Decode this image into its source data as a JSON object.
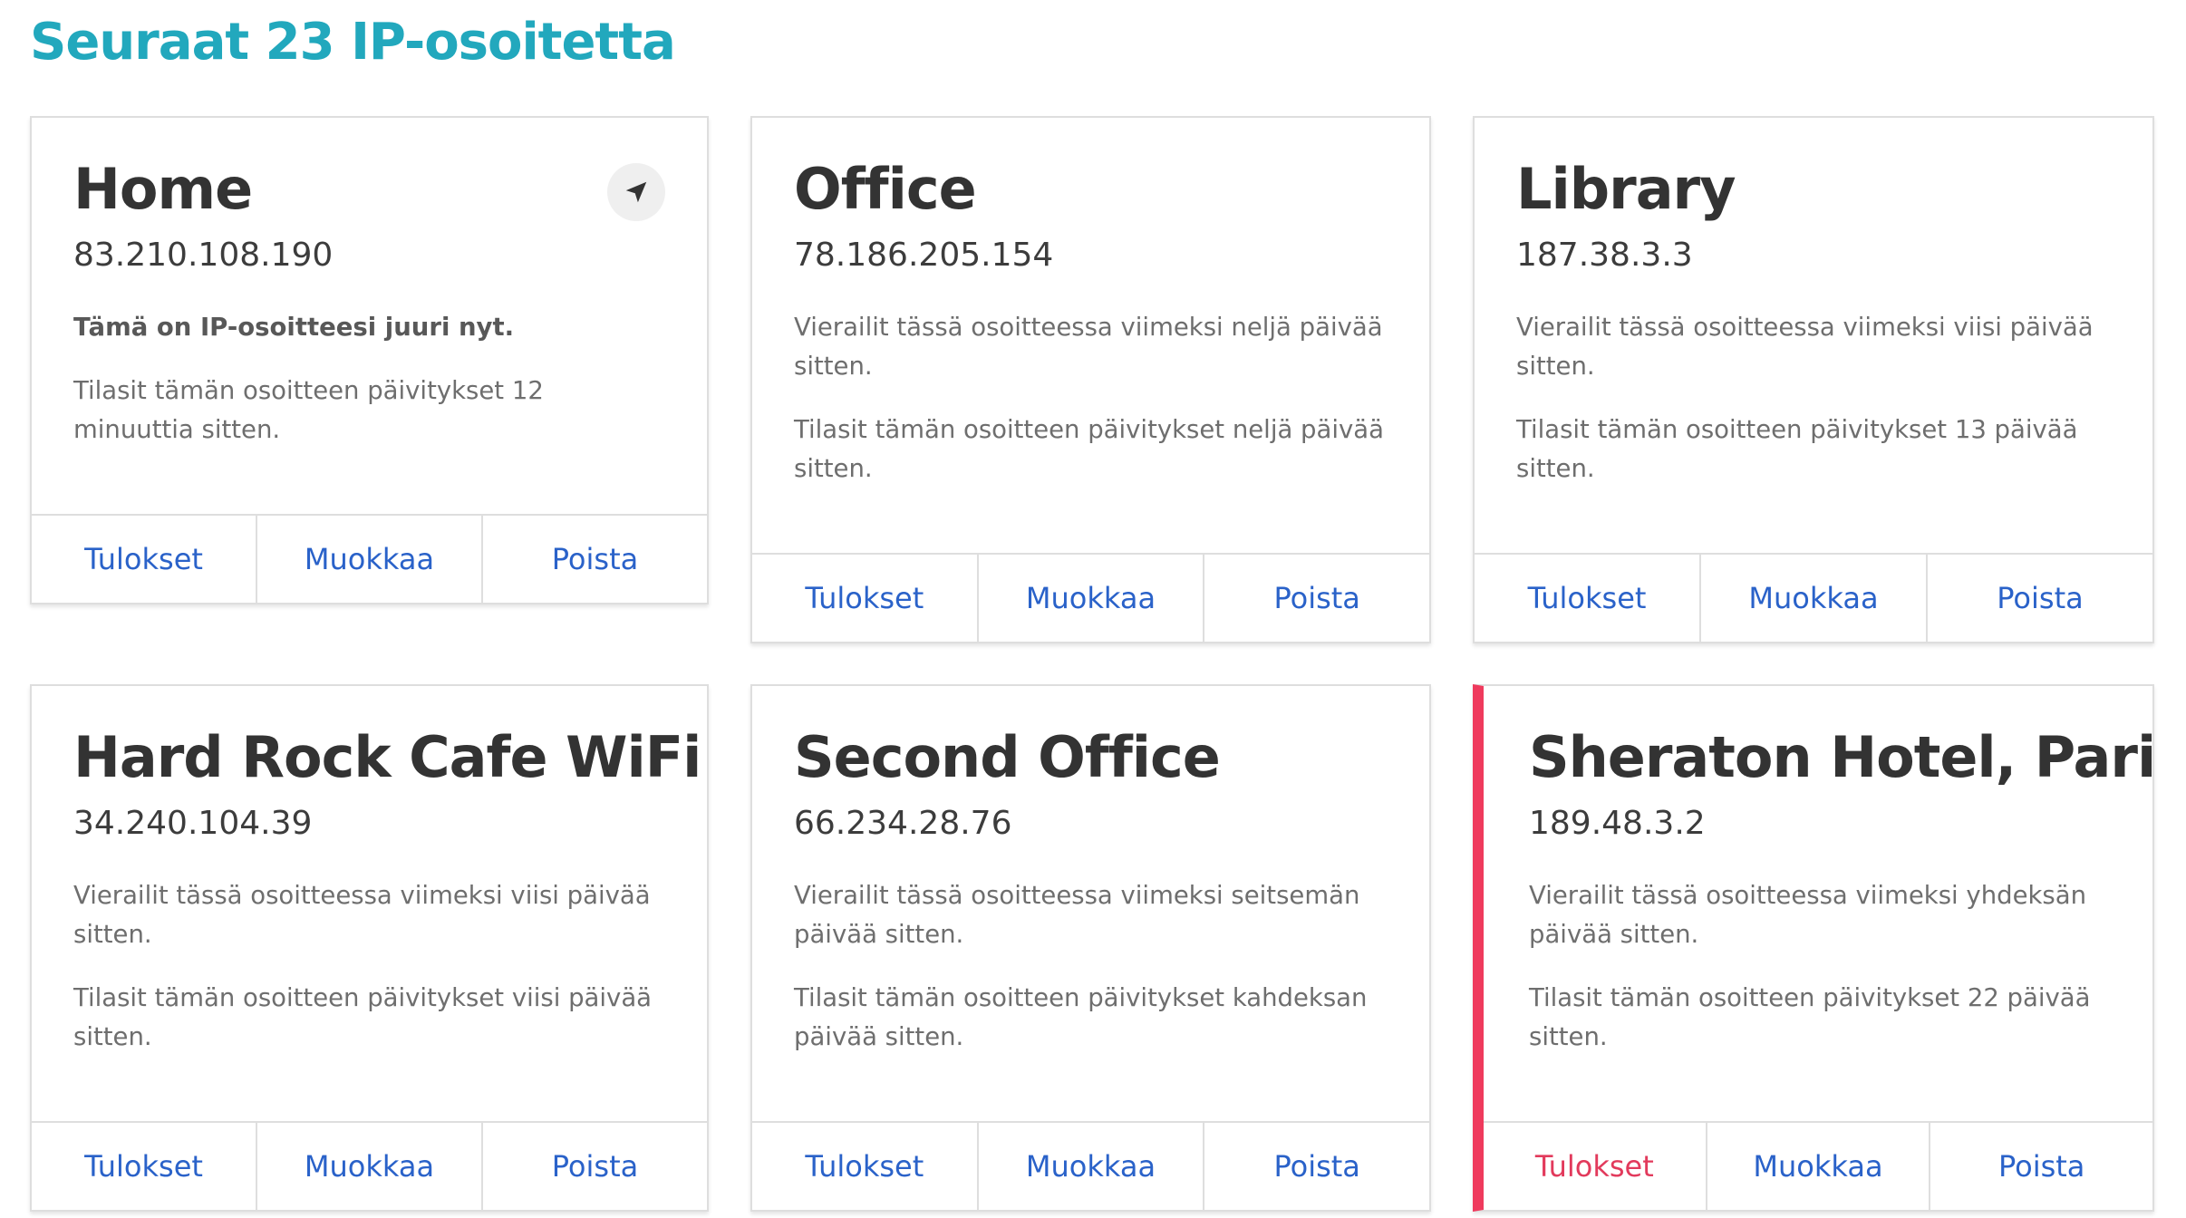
{
  "page": {
    "title": "Seuraat 23 IP-osoitetta"
  },
  "colors": {
    "accent": "#22a8bd",
    "link": "#2a62c9",
    "alert": "#ef3a5d"
  },
  "cards": [
    {
      "name": "Home",
      "ip": "83.210.108.190",
      "current_note": "Tämä on IP-osoitteesi juuri nyt.",
      "subscribed_note": "Tilasit tämän osoitteen päivitykset 12 minuuttia sitten.",
      "icon": "location-arrow-icon",
      "actions": {
        "results": "Tulokset",
        "edit": "Muokkaa",
        "delete": "Poista"
      }
    },
    {
      "name": "Office",
      "ip": "78.186.205.154",
      "visited_note": "Vierailit tässä osoitteessa viimeksi neljä päivää sitten.",
      "subscribed_note": "Tilasit tämän osoitteen päivitykset neljä päivää sitten.",
      "actions": {
        "results": "Tulokset",
        "edit": "Muokkaa",
        "delete": "Poista"
      }
    },
    {
      "name": "Library",
      "ip": "187.38.3.3",
      "visited_note": "Vierailit tässä osoitteessa viimeksi viisi päivää sitten.",
      "subscribed_note": "Tilasit tämän osoitteen päivitykset 13 päivää sitten.",
      "actions": {
        "results": "Tulokset",
        "edit": "Muokkaa",
        "delete": "Poista"
      }
    },
    {
      "name": "Hard Rock Cafe WiFi",
      "ip": "34.240.104.39",
      "visited_note": "Vierailit tässä osoitteessa viimeksi viisi päivää sitten.",
      "subscribed_note": "Tilasit tämän osoitteen päivitykset viisi päivää sitten.",
      "actions": {
        "results": "Tulokset",
        "edit": "Muokkaa",
        "delete": "Poista"
      }
    },
    {
      "name": "Second Office",
      "ip": "66.234.28.76",
      "visited_note": "Vierailit tässä osoitteessa viimeksi seitsemän päivää sitten.",
      "subscribed_note": "Tilasit tämän osoitteen päivitykset kahdeksan päivää sitten.",
      "actions": {
        "results": "Tulokset",
        "edit": "Muokkaa",
        "delete": "Poista"
      }
    },
    {
      "name": "Sheraton Hotel, Paris",
      "ip": "189.48.3.2",
      "visited_note": "Vierailit tässä osoitteessa viimeksi yhdeksän päivää sitten.",
      "subscribed_note": "Tilasit tämän osoitteen päivitykset 22 päivää sitten.",
      "alert": true,
      "actions": {
        "results": "Tulokset",
        "edit": "Muokkaa",
        "delete": "Poista"
      }
    }
  ]
}
